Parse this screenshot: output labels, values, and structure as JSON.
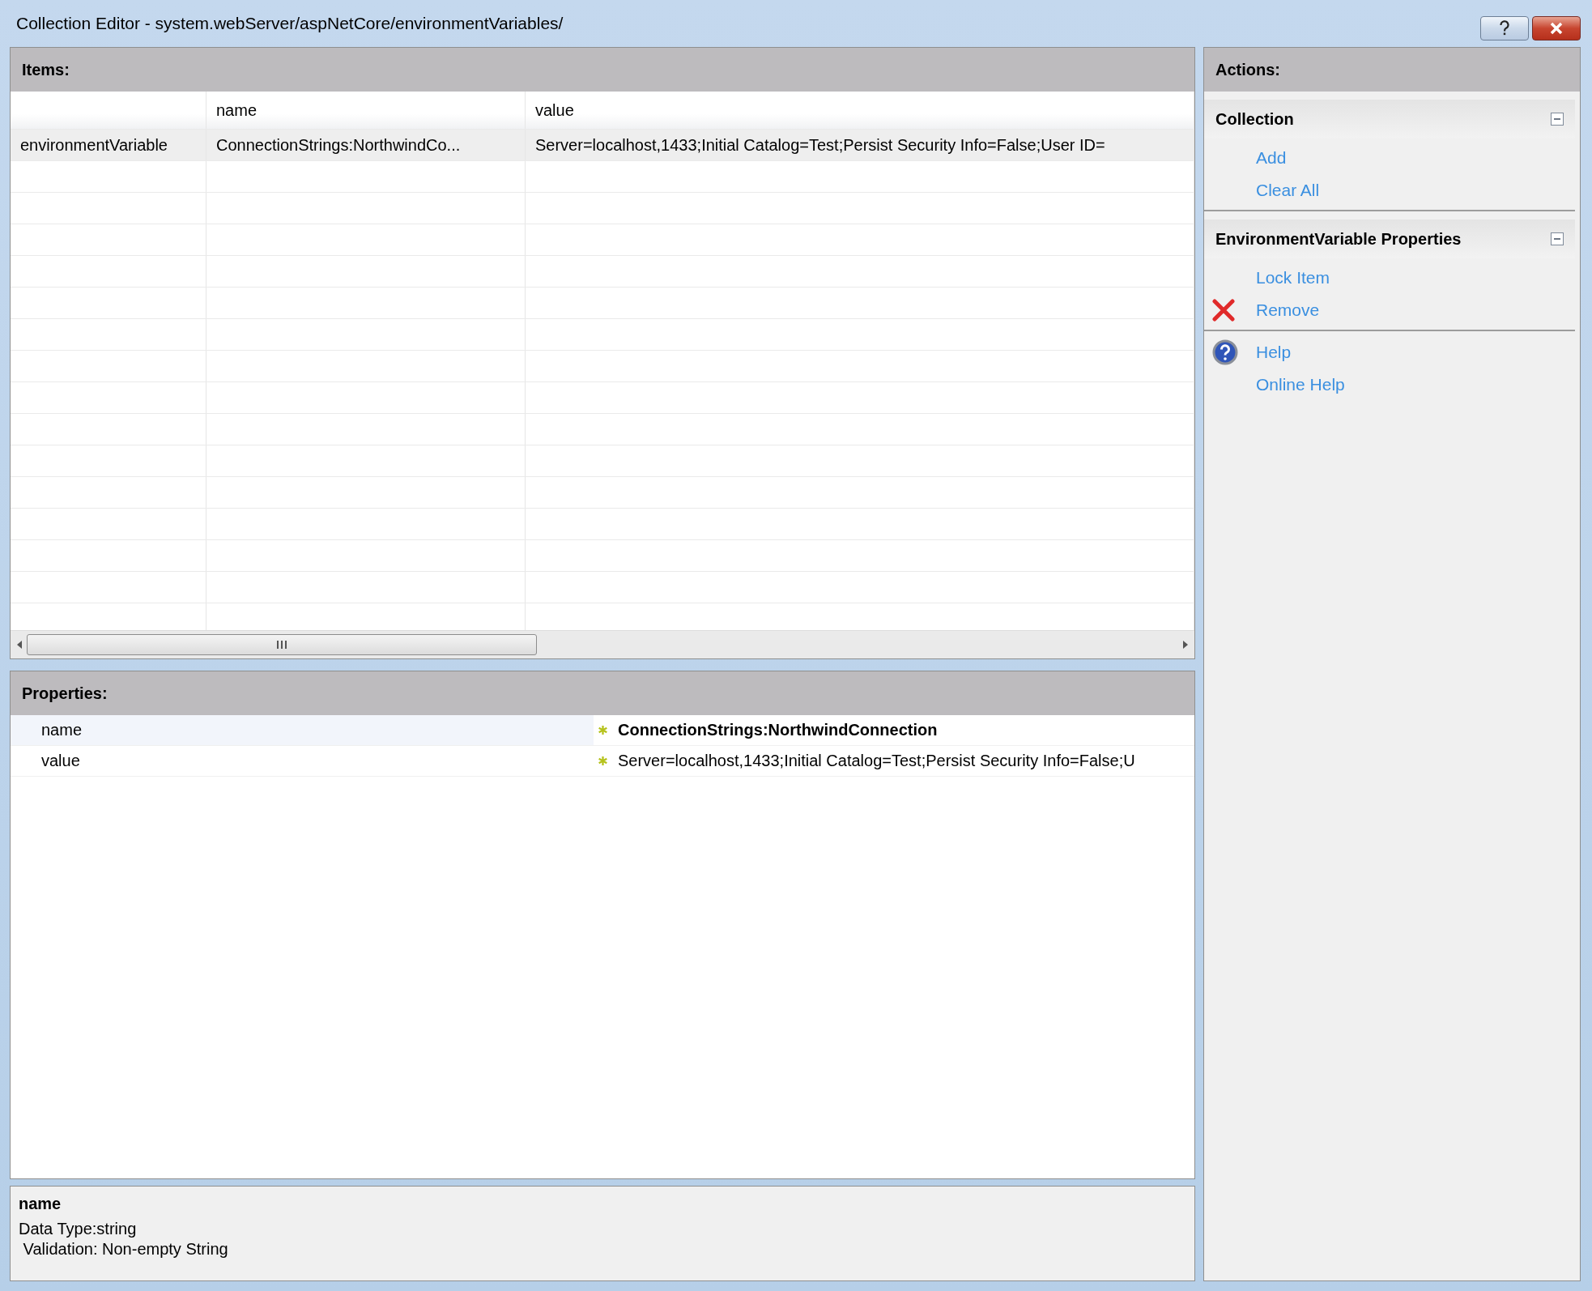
{
  "window": {
    "title": "Collection Editor - system.webServer/aspNetCore/environmentVariables/"
  },
  "items": {
    "header": "Items:",
    "columns": [
      "",
      "name",
      "value"
    ],
    "rows": [
      {
        "cells": [
          "environmentVariable",
          "ConnectionStrings:NorthwindCo...",
          "Server=localhost,1433;Initial Catalog=Test;Persist Security Info=False;User ID="
        ],
        "selected": true
      }
    ]
  },
  "properties": {
    "header": "Properties:",
    "rows": [
      {
        "name": "name",
        "value": "ConnectionStrings:NorthwindConnection",
        "required": true,
        "selected": true
      },
      {
        "name": "value",
        "value": "Server=localhost,1433;Initial Catalog=Test;Persist Security Info=False;U",
        "required": true,
        "selected": false
      }
    ]
  },
  "description": {
    "title": "name",
    "lines": [
      "Data Type:string",
      " Validation: Non-empty String"
    ]
  },
  "actions": {
    "header": "Actions:",
    "groups": [
      {
        "title": "Collection",
        "expanded": true,
        "items": [
          {
            "label": "Add",
            "kind": "plain"
          },
          {
            "label": "Clear All",
            "kind": "plain"
          }
        ]
      },
      {
        "title": "EnvironmentVariable Properties",
        "expanded": true,
        "items": [
          {
            "label": "Lock Item",
            "kind": "plain"
          },
          {
            "label": "Remove",
            "kind": "remove"
          }
        ]
      },
      {
        "items": [
          {
            "label": "Help",
            "kind": "help"
          },
          {
            "label": "Online Help",
            "kind": "plain"
          }
        ]
      }
    ]
  }
}
